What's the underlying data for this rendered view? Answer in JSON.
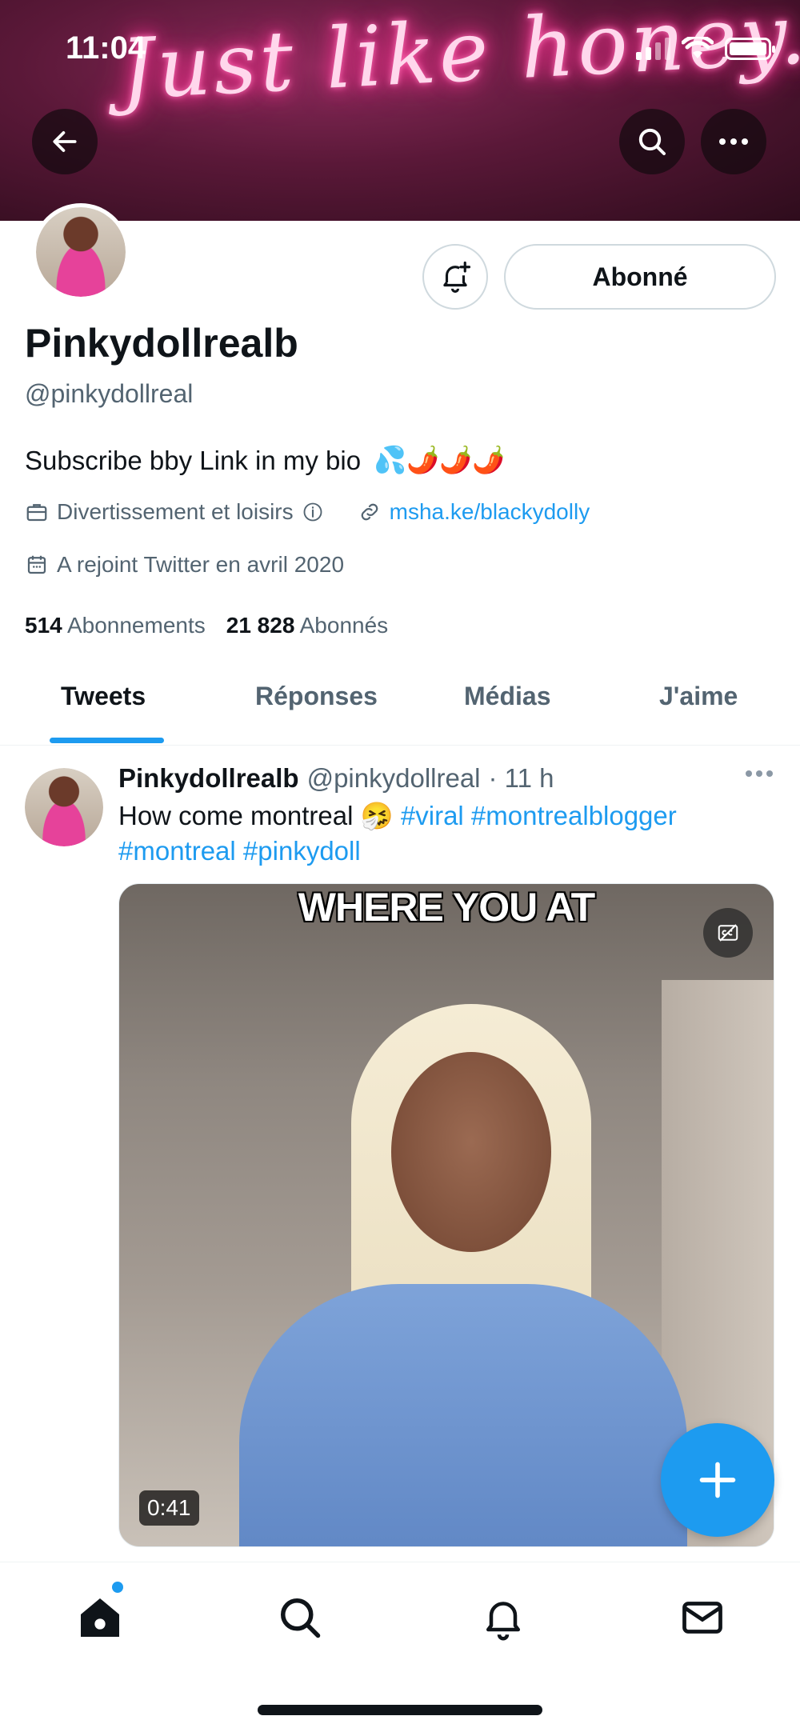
{
  "status_bar": {
    "time": "11:04"
  },
  "banner": {
    "neon_text": "Just like honey...x"
  },
  "profile": {
    "follow_button": "Abonné",
    "display_name": "Pinkydollrealb",
    "handle": "@pinkydollreal",
    "bio": "Subscribe bby Link in my bio",
    "bio_emojis": "💦🌶️🌶️🌶️",
    "category": "Divertissement et loisirs",
    "link": "msha.ke/blackydolly",
    "joined": "A rejoint Twitter en avril 2020",
    "following_count": "514",
    "following_label": "Abonnements",
    "followers_count": "21 828",
    "followers_label": "Abonnés"
  },
  "tabs": [
    {
      "label": "Tweets",
      "active": true
    },
    {
      "label": "Réponses",
      "active": false
    },
    {
      "label": "Médias",
      "active": false
    },
    {
      "label": "J'aime",
      "active": false
    }
  ],
  "tweet": {
    "name": "Pinkydollrealb",
    "handle": "@pinkydollreal",
    "time": "· 11 h",
    "text": "How come montreal",
    "emoji": "🤧",
    "hashtags": [
      "#viral",
      "#montrealblogger",
      "#montreal",
      "#pinkydoll"
    ],
    "media": {
      "caption": "WHERE YOU AT",
      "duration": "0:41"
    }
  },
  "colors": {
    "accent": "#1d9bf0",
    "text_primary": "#0f1419",
    "text_secondary": "#536471"
  },
  "icons": {
    "back": "arrow-left-icon",
    "search": "search-icon",
    "more": "more-horizontal-icon",
    "bell": "bell-plus-icon",
    "briefcase": "briefcase-icon",
    "info": "info-icon",
    "link": "link-icon",
    "calendar": "calendar-icon",
    "fab": "plus-icon",
    "nav_home": "home-icon",
    "nav_search": "search-icon",
    "nav_notifications": "bell-icon",
    "nav_messages": "mail-icon"
  }
}
